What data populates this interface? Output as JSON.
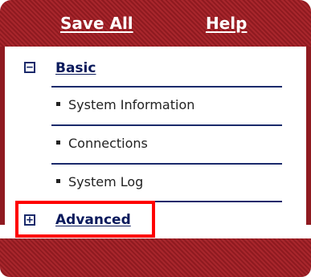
{
  "header": {
    "save_all": "Save All",
    "help": "Help"
  },
  "menu": {
    "basic": {
      "toggle": "−",
      "label": "Basic",
      "items": [
        {
          "label": "System Information"
        },
        {
          "label": "Connections"
        },
        {
          "label": "System Log"
        }
      ]
    },
    "advanced": {
      "toggle": "+",
      "label": "Advanced"
    }
  },
  "colors": {
    "brand_red": "#a8262c",
    "link_blue": "#0a1a5c",
    "highlight": "#ff0000"
  }
}
